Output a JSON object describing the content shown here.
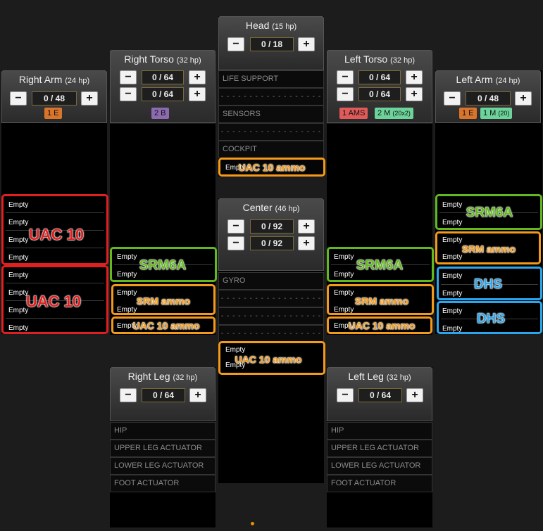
{
  "colors": {
    "red": "#e02020",
    "green": "#62b81f",
    "orange": "#f39a1b",
    "blue": "#2aa6ef",
    "badge_orange": "#d9752b",
    "badge_purple": "#8c6bb0",
    "badge_red": "#e05a5a",
    "badge_green": "#6cd39a"
  },
  "icons": {
    "minus": "minus-icon",
    "plus": "plus-icon"
  },
  "controls": {
    "minus": "−",
    "plus": "+"
  },
  "head": {
    "name": "Head",
    "hp": "(15 hp)",
    "armor": "0 / 18",
    "slots": [
      "LIFE SUPPORT",
      "- - - - - - - - - - - - - - - - - -",
      "SENSORS",
      "- - - - - - - - - - - - - - - - - -",
      "COCKPIT",
      "Empty"
    ],
    "item": "UAC 10 ammo"
  },
  "right_torso": {
    "name": "Right Torso",
    "hp": "(32 hp)",
    "armor_front": "0 / 64",
    "armor_rear": "0 / 64",
    "badge": "2 B",
    "slots": [
      "Empty",
      "Empty",
      "Empty",
      "Empty",
      "Empty",
      "Empty"
    ],
    "items": [
      "SRM6A",
      "SRM ammo",
      "UAC 10 ammo"
    ]
  },
  "center": {
    "name": "Center",
    "hp": "(46 hp)",
    "armor_front": "0 / 92",
    "armor_rear": "0 / 92",
    "slots": [
      "GYRO",
      "- - - - - - - - - - - - - - - - - -",
      "- - - - - - - - - - - - - - - - - -",
      "- - - - - - - - - - - - - - - - - -",
      "Empty",
      "Empty"
    ],
    "item": "UAC 10 ammo"
  },
  "left_torso": {
    "name": "Left Torso",
    "hp": "(32 hp)",
    "armor_front": "0 / 64",
    "armor_rear": "0 / 64",
    "badges": [
      {
        "text": "1 AMS",
        "sub": ""
      },
      {
        "text": "2 M",
        "sub": "(20x2)"
      }
    ],
    "slots": [
      "Empty",
      "Empty",
      "Empty",
      "Empty",
      "Empty",
      "Empty"
    ],
    "items": [
      "SRM6A",
      "SRM ammo",
      "UAC 10 ammo"
    ]
  },
  "right_arm": {
    "name": "Right Arm",
    "hp": "(24 hp)",
    "armor": "0 / 48",
    "badge": "1 E",
    "slots": [
      "Empty",
      "Empty",
      "Empty",
      "Empty",
      "Empty",
      "Empty",
      "Empty",
      "Empty"
    ],
    "items": [
      "UAC 10",
      "UAC 10"
    ]
  },
  "left_arm": {
    "name": "Left Arm",
    "hp": "(24 hp)",
    "armor": "0 / 48",
    "badges": [
      {
        "text": "1 E",
        "sub": ""
      },
      {
        "text": "1 M",
        "sub": "(20)"
      }
    ],
    "slots": [
      "Empty",
      "Empty",
      "Empty",
      "Empty",
      "Empty",
      "Empty",
      "Empty",
      "Empty"
    ],
    "items": [
      "SRM6A",
      "SRM ammo",
      "DHS",
      "DHS"
    ]
  },
  "right_leg": {
    "name": "Right Leg",
    "hp": "(32 hp)",
    "armor": "0 / 64",
    "slots": [
      "HIP",
      "UPPER LEG ACTUATOR",
      "LOWER LEG ACTUATOR",
      "FOOT ACTUATOR"
    ]
  },
  "left_leg": {
    "name": "Left Leg",
    "hp": "(32 hp)",
    "armor": "0 / 64",
    "slots": [
      "HIP",
      "UPPER LEG ACTUATOR",
      "LOWER LEG ACTUATOR",
      "FOOT ACTUATOR"
    ]
  }
}
